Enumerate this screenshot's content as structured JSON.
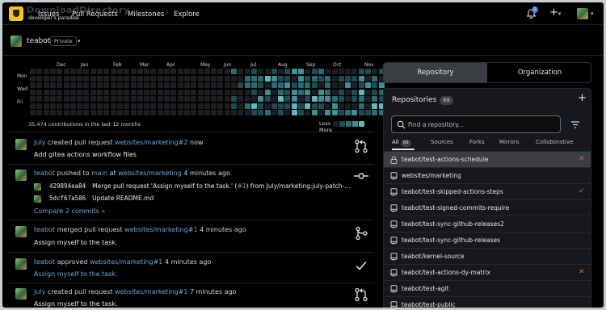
{
  "watermark": {
    "title": "DownloadDirectory",
    "subtitle": "developer's paradise"
  },
  "nav": {
    "issues": "Issues",
    "pulls": "Pull Requests",
    "milestones": "Milestones",
    "explore": "Explore",
    "notif_count": "1",
    "plus": "+",
    "caret": "▾"
  },
  "context": {
    "name": "teabot",
    "badge": "Private",
    "caret": "▾"
  },
  "heatmap": {
    "months": [
      "Dec",
      "Jan",
      "Feb",
      "Mar",
      "Apr",
      "May",
      "Jun",
      "Jul",
      "Aug",
      "Sep",
      "Oct",
      "Nov"
    ],
    "days": [
      "Mon",
      "Wed",
      "Fri"
    ],
    "contributions": "35,474 contributions in the last 12 months",
    "less": "Less",
    "more": "More",
    "colors": [
      "#1c1e21",
      "#1e4c52",
      "#2c6b72",
      "#3f8f96",
      "#63b7bd"
    ]
  },
  "feed": [
    {
      "actor": "July",
      "action": " created pull request ",
      "target": "websites/marketing#2",
      "time": " now",
      "sub": "Add gitea actions workflow files",
      "icon": "pull-request-icon"
    },
    {
      "actor": "teabot",
      "action": " pushed to ",
      "branch": "main",
      "at": " at ",
      "target": "websites/marketing",
      "time": " 4 minutes ago",
      "commits": [
        {
          "sha": "429894ea84",
          "msg": "Merge pull request 'Assign myself to the task.' (",
          "ref": "#1",
          "msg2": ") from July/marketing:july-patch-..."
        },
        {
          "sha": "5dcf67a586",
          "msg": "Update README.md",
          "ref": "",
          "msg2": ""
        }
      ],
      "compare": "Compare 2 commits »",
      "icon": "commit-icon"
    },
    {
      "actor": "teabot",
      "action": " merged pull request ",
      "target": "websites/marketing#1",
      "time": " 4 minutes ago",
      "sub": "Assign myself to the task.",
      "icon": "merge-icon"
    },
    {
      "actor": "teabot",
      "action": " approved ",
      "target": "websites/marketing#1",
      "time": " 4 minutes ago",
      "sub": "Assign myself to the task.",
      "icon": "check-icon"
    },
    {
      "actor": "July",
      "action": " created pull request ",
      "target": "websites/marketing#1",
      "time": " 7 minutes ago",
      "sub": "Assign myself to the task.",
      "icon": "pull-request-icon"
    }
  ],
  "right": {
    "tab_repo": "Repository",
    "tab_org": "Organization",
    "repos_title": "Repositories",
    "repos_count": "69",
    "plus": "+",
    "search_placeholder": "Find a repository...",
    "filters": {
      "all": "All",
      "all_count": "69",
      "sources": "Sources",
      "forks": "Forks",
      "mirrors": "Mirrors",
      "collab": "Collaborative"
    },
    "repos": [
      {
        "name": "teabot/test-actions-schedule",
        "status": "✕",
        "kind": "lock"
      },
      {
        "name": "websites/marketing",
        "status": "",
        "kind": "repo"
      },
      {
        "name": "teabot/test-skipped-actions-steps",
        "status": "✓",
        "kind": "repo"
      },
      {
        "name": "teabot/test-signed-commits-require",
        "status": "",
        "kind": "repo"
      },
      {
        "name": "teabot/test-sync-github-releases2",
        "status": "",
        "kind": "repo"
      },
      {
        "name": "teabot/test-sync-github-releases",
        "status": "",
        "kind": "repo"
      },
      {
        "name": "teabot/kernel-source",
        "status": "",
        "kind": "repo"
      },
      {
        "name": "teabot/test-actions-dy-matrix",
        "status": "✕",
        "kind": "repo"
      },
      {
        "name": "teabot/test-agit",
        "status": "",
        "kind": "repo"
      },
      {
        "name": "teabot/test-public",
        "status": "",
        "kind": "repo"
      }
    ]
  }
}
